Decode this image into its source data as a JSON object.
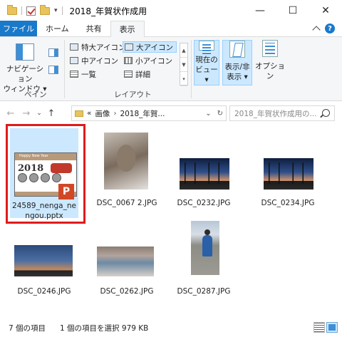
{
  "window": {
    "title": "2018_年賀状作成用",
    "minimize": "—",
    "maximize": "☐",
    "close": "✕"
  },
  "ribbon_tabs": {
    "file": "ファイル",
    "home": "ホーム",
    "share": "共有",
    "view": "表示"
  },
  "ribbon": {
    "nav_pane_label_1": "ナビゲーション",
    "nav_pane_label_2": "ウィンドウ ▾",
    "pane_group": "ペイン",
    "layout_group": "レイアウト",
    "layout_items": {
      "extra_large": "特大アイコン",
      "large": "大アイコン",
      "medium": "中アイコン",
      "small": "小アイコン",
      "list": "一覧",
      "details": "詳細"
    },
    "current_view_1": "現在の",
    "current_view_2": "ビュー ▾",
    "show_hide_1": "表示/非",
    "show_hide_2": "表示 ▾",
    "options": "オプション"
  },
  "address": {
    "chevron": "«",
    "crumb_1": "画像",
    "crumb_2": "2018_年賀...",
    "search_placeholder": "2018_年賀状作成用の..."
  },
  "files": [
    {
      "name_1": "24589_nenga_ne",
      "name_2": "ngou.pptx"
    },
    {
      "name_1": "DSC_0067 2.JPG",
      "name_2": ""
    },
    {
      "name_1": "DSC_0232.JPG",
      "name_2": ""
    },
    {
      "name_1": "DSC_0234.JPG",
      "name_2": ""
    },
    {
      "name_1": "DSC_0246.JPG",
      "name_2": ""
    },
    {
      "name_1": "DSC_0262.JPG",
      "name_2": ""
    },
    {
      "name_1": "DSC_0287.JPG",
      "name_2": ""
    }
  ],
  "pptx_thumb": {
    "header": "Happy New Year",
    "year": "2018",
    "badge": "P"
  },
  "status": {
    "item_count": "7 個の項目",
    "selected": "1 個の項目を選択 979 KB"
  },
  "colors": {
    "accent": "#1979ca",
    "selection": "#cce8ff",
    "highlight_frame": "#e01b1b"
  }
}
